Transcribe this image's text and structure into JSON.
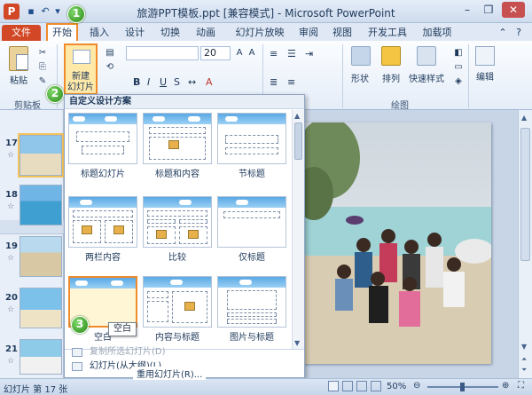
{
  "window": {
    "title": "旅游PPT模板.ppt [兼容模式] - Microsoft PowerPoint",
    "logo": "P"
  },
  "tabs": [
    "文件",
    "开始",
    "插入",
    "设计",
    "切换",
    "动画",
    "幻灯片放映",
    "审阅",
    "视图",
    "开发工具",
    "加载项"
  ],
  "ribbon": {
    "paste": "粘贴",
    "new_slide": "新建\n幻灯片",
    "new_slide_line1": "新建",
    "new_slide_line2": "幻灯片",
    "font_size": "20",
    "shape": "形状",
    "arrange": "排列",
    "quick_styles": "快速样式",
    "edit": "编辑",
    "group_clipboard": "剪贴板",
    "group_drawing": "绘图"
  },
  "steps": [
    "1",
    "2",
    "3"
  ],
  "gallery": {
    "header": "自定义设计方案",
    "layouts": [
      {
        "label": "标题幻灯片"
      },
      {
        "label": "标题和内容"
      },
      {
        "label": "节标题"
      },
      {
        "label": "两栏内容"
      },
      {
        "label": "比较"
      },
      {
        "label": "仅标题"
      },
      {
        "label": "空白"
      },
      {
        "label": "内容与标题"
      },
      {
        "label": "图片与标题"
      }
    ],
    "tooltip": "空白",
    "menu": [
      "复制所选幻灯片(D)",
      "幻灯片(从大纲)(L)...",
      "重用幻灯片(R)..."
    ]
  },
  "slides_panel": {
    "numbers": [
      "17",
      "18",
      "19",
      "20",
      "21"
    ]
  },
  "statusbar": {
    "slide_info": "幻灯片 第 17 张",
    "zoom": "50%"
  },
  "colors": {
    "file_tab": "#d24726",
    "highlight": "#f08b2c",
    "step_marker": "#2b8a18"
  }
}
